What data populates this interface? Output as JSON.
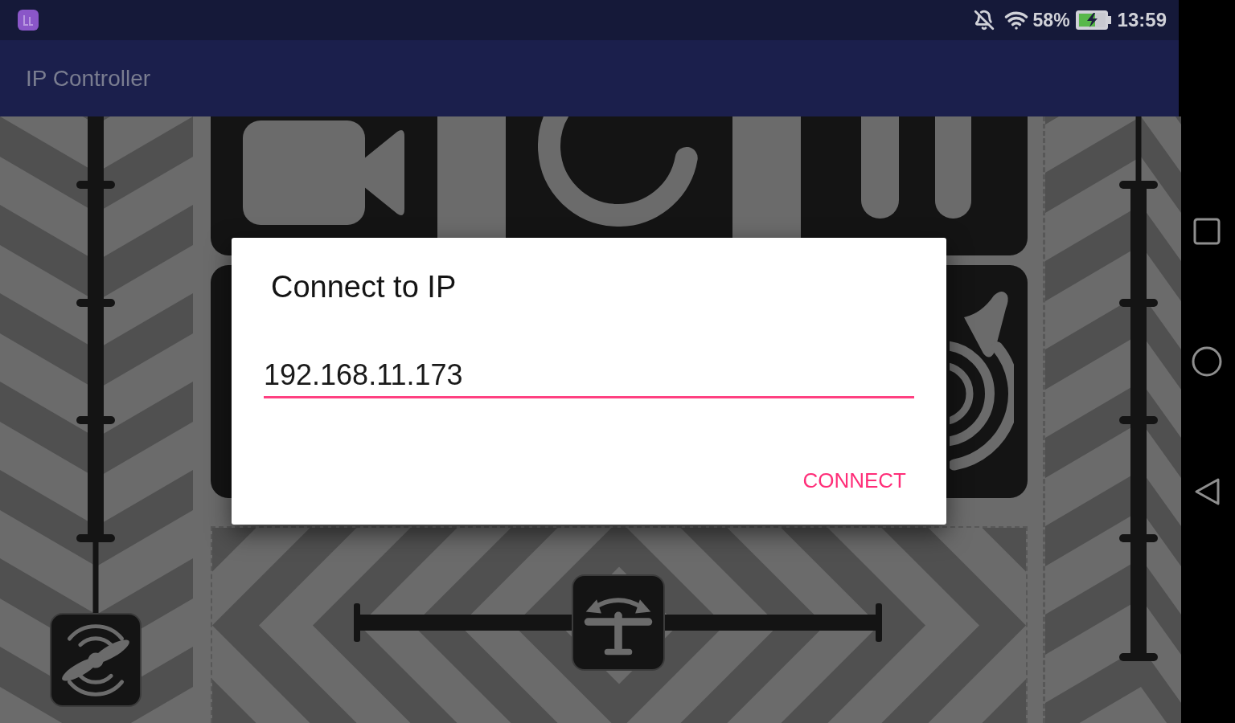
{
  "status_bar": {
    "battery": "58%",
    "time": "13:59"
  },
  "app_bar": {
    "title": "IP Controller"
  },
  "left_slider": {
    "level": 0
  },
  "bottom_slider": {
    "level": 0.5
  },
  "dialog": {
    "title": "Connect to IP",
    "ip_field": {
      "value": "192.168.11.173",
      "focused": true
    },
    "buttons": [
      "CONNECT"
    ]
  }
}
